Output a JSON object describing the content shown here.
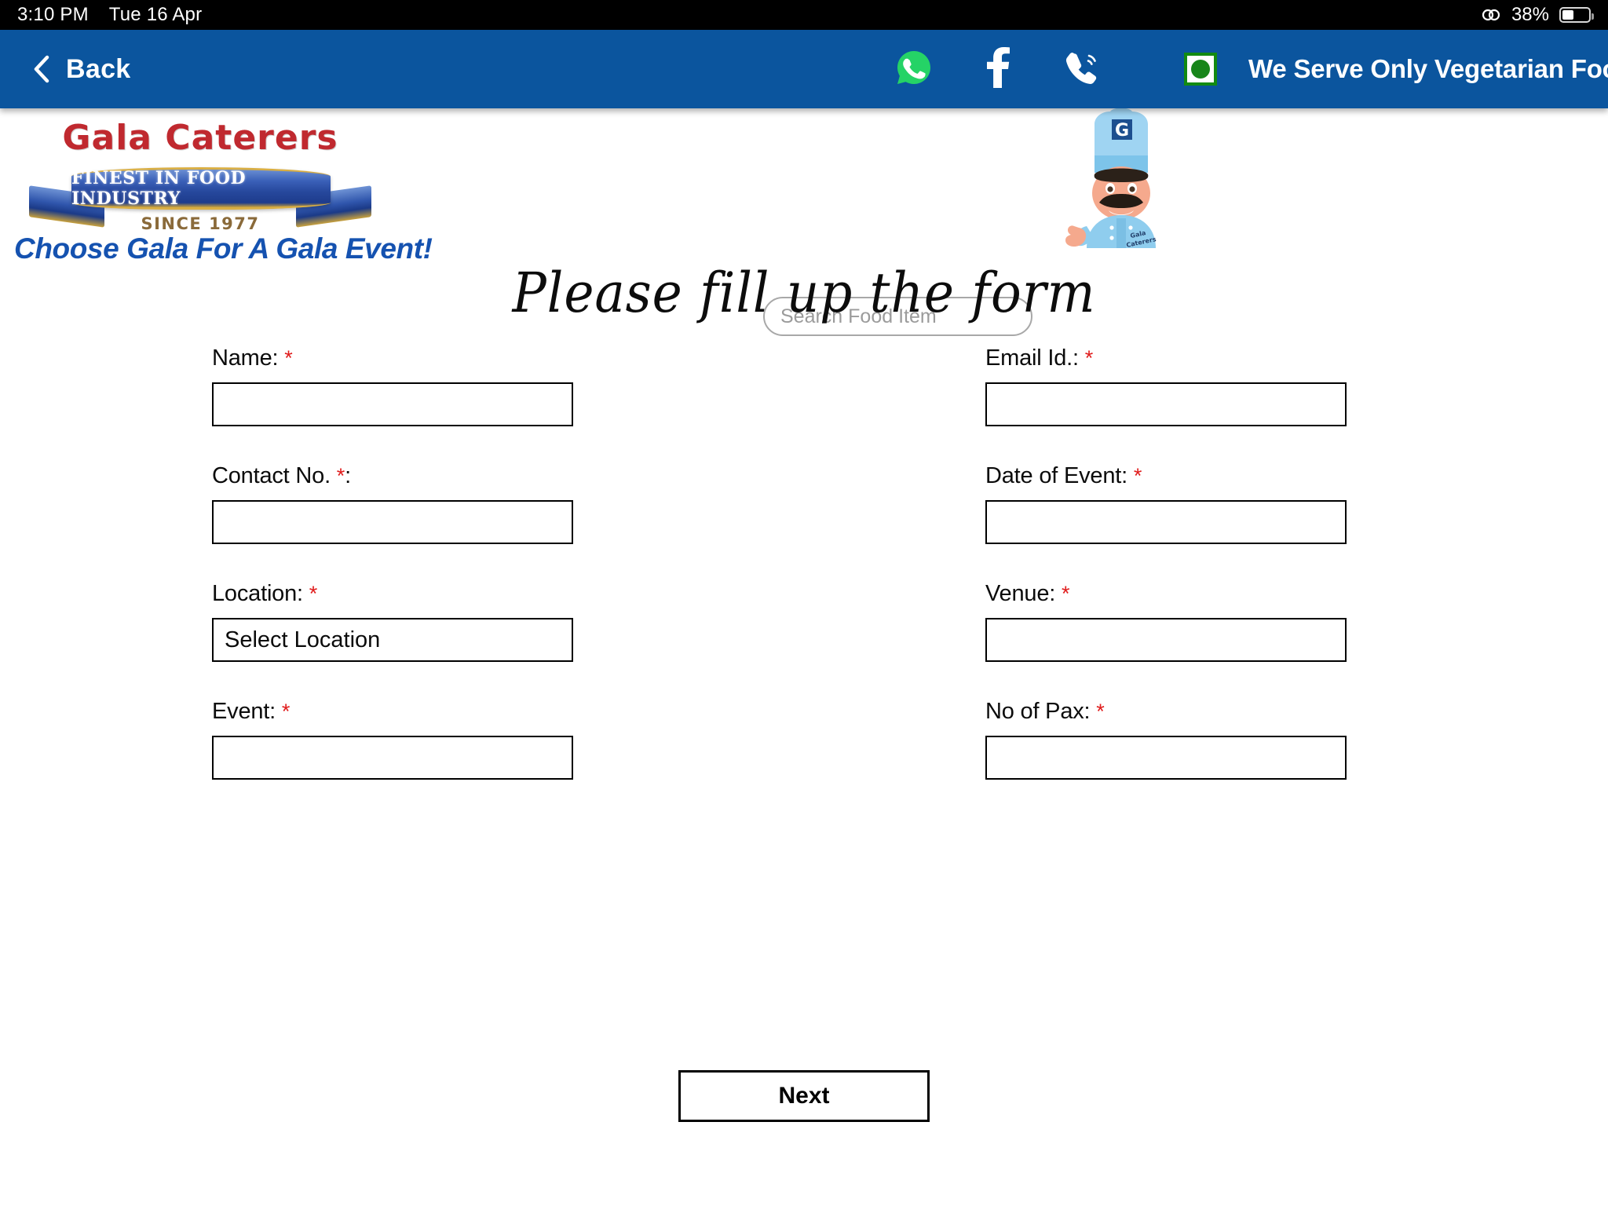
{
  "statusbar": {
    "time": "3:10 PM",
    "date": "Tue 16 Apr",
    "battery_percent": "38%",
    "battery_level": 38,
    "link_icon": "screen-mirroring-icon"
  },
  "navbar": {
    "back_label": "Back",
    "back_icon": "chevron-left-icon",
    "social": [
      {
        "name": "whatsapp-icon",
        "color": "#25d366"
      },
      {
        "name": "facebook-icon",
        "color": "#ffffff"
      },
      {
        "name": "phone-call-icon",
        "color": "#ffffff"
      }
    ],
    "veg_text": "We Serve Only Vegetarian Food",
    "veg_icon": "vegetarian-mark-icon",
    "bg_color": "#0b559e"
  },
  "brand": {
    "title": "Gala Caterers",
    "ribbon_text": "FINEST IN FOOD INDUSTRY",
    "since": "SINCE 1977",
    "tagline": "Choose Gala For A Gala Event!",
    "title_color": "#c0292f",
    "tagline_color": "#1552b0",
    "mascot_icon": "chef-mascot-icon"
  },
  "search": {
    "placeholder": "Search Food Item",
    "value": "",
    "button_icon": "search-icon",
    "button_color": "#f9a81a"
  },
  "form": {
    "title": "Please fill up the form",
    "required_marker": "*",
    "required_color": "#e01c1c",
    "fields": [
      {
        "label": "Name:",
        "required": true,
        "value": "",
        "type": "text",
        "name": "name"
      },
      {
        "label": "Email Id.:",
        "required": true,
        "value": "",
        "type": "text",
        "name": "email"
      },
      {
        "label": "Contact No. *:",
        "required": false,
        "value": "",
        "type": "text",
        "name": "contact"
      },
      {
        "label": "Date of Event:",
        "required": true,
        "value": "",
        "type": "text",
        "name": "date-of-event"
      },
      {
        "label": "Location:",
        "required": true,
        "value": "Select Location",
        "type": "select",
        "name": "location"
      },
      {
        "label": "Venue:",
        "required": true,
        "value": "",
        "type": "text",
        "name": "venue"
      },
      {
        "label": "Event:",
        "required": true,
        "value": "",
        "type": "text",
        "name": "event"
      },
      {
        "label": "No of Pax:",
        "required": true,
        "value": "",
        "type": "text",
        "name": "no-of-pax"
      }
    ],
    "submit_label": "Next"
  }
}
